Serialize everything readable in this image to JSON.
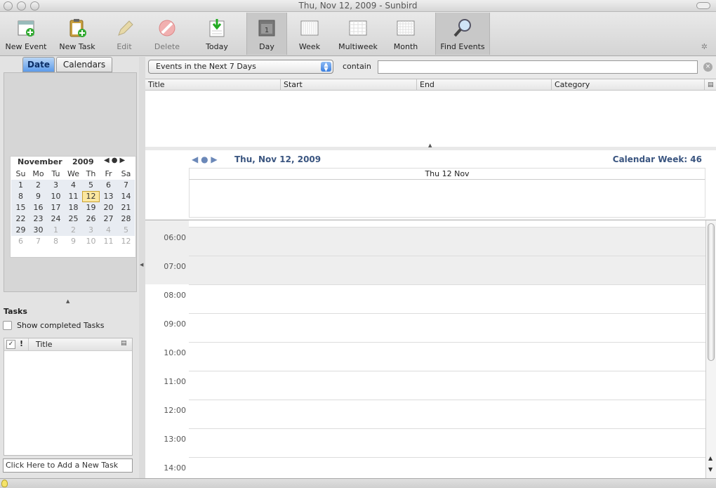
{
  "window": {
    "title": "Thu, Nov 12, 2009 - Sunbird"
  },
  "toolbar": {
    "new_event": "New Event",
    "new_task": "New Task",
    "edit": "Edit",
    "delete": "Delete",
    "today": "Today",
    "day": "Day",
    "week": "Week",
    "multiweek": "Multiweek",
    "month": "Month",
    "find_events": "Find Events"
  },
  "left": {
    "tabs": {
      "date": "Date",
      "calendars": "Calendars"
    },
    "minimonth": {
      "month": "November",
      "year": "2009",
      "weekdays": [
        "Su",
        "Mo",
        "Tu",
        "We",
        "Th",
        "Fr",
        "Sa"
      ],
      "weeks": [
        [
          "1",
          "2",
          "3",
          "4",
          "5",
          "6",
          "7"
        ],
        [
          "8",
          "9",
          "10",
          "11",
          "12",
          "13",
          "14"
        ],
        [
          "15",
          "16",
          "17",
          "18",
          "19",
          "20",
          "21"
        ],
        [
          "22",
          "23",
          "24",
          "25",
          "26",
          "27",
          "28"
        ],
        [
          "29",
          "30",
          "1",
          "2",
          "3",
          "4",
          "5"
        ],
        [
          "6",
          "7",
          "8",
          "9",
          "10",
          "11",
          "12"
        ]
      ],
      "today": "12"
    },
    "tasks": {
      "heading": "Tasks",
      "show_completed": "Show completed Tasks",
      "col_title": "Title",
      "add_placeholder": "Click Here to Add a New Task"
    }
  },
  "main": {
    "filter": {
      "selected": "Events in the Next 7 Days",
      "contain_label": "contain",
      "search_value": ""
    },
    "unifinder": {
      "columns": [
        "Title",
        "Start",
        "End",
        "Category"
      ]
    },
    "day": {
      "date_label": "Thu, Nov 12, 2009",
      "week_label": "Calendar Week: 46",
      "column_header": "Thu 12 Nov",
      "hours": [
        "06:00",
        "07:00",
        "08:00",
        "09:00",
        "10:00",
        "11:00",
        "12:00",
        "13:00",
        "14:00"
      ]
    }
  }
}
